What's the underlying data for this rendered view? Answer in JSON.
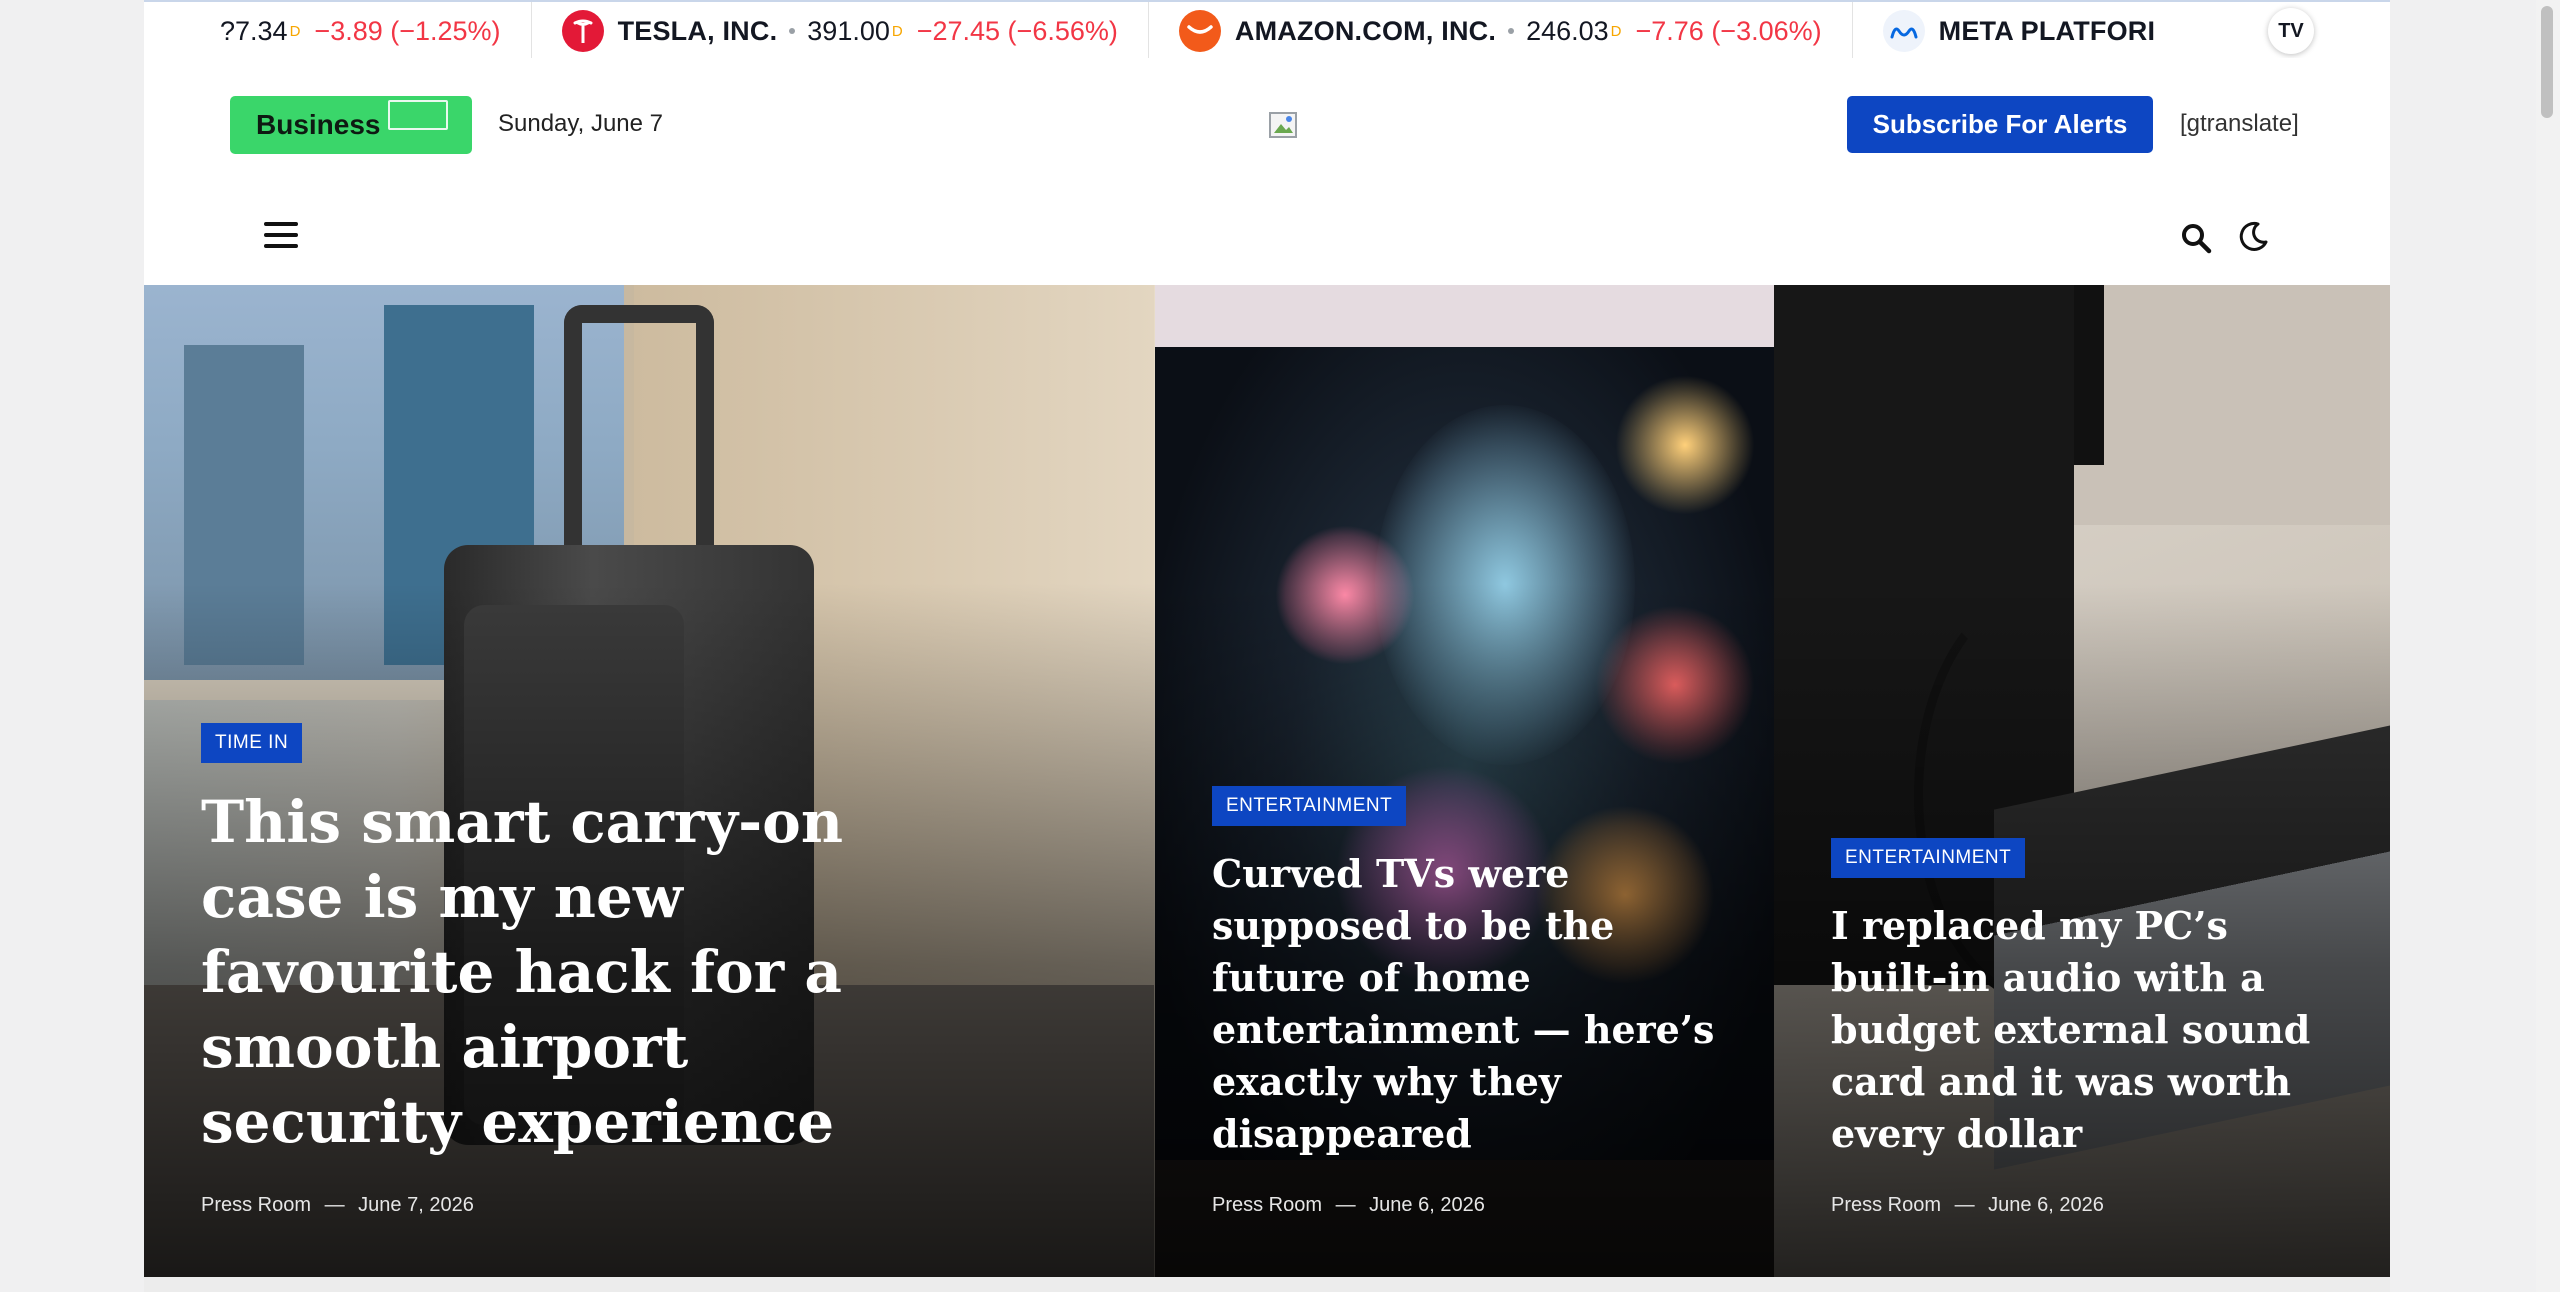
{
  "ticker": {
    "items": [
      {
        "partial_price": "?7.34",
        "sup": "D",
        "change": "−3.89 (−1.25%)"
      },
      {
        "logo": "tesla-logo",
        "logo_color": "#e31937",
        "name": "TESLA, INC.",
        "price": "391.00",
        "sup": "D",
        "change": "−27.45 (−6.56%)"
      },
      {
        "logo": "amazon-logo",
        "logo_color": "#f25a1a",
        "name": "AMAZON.COM, INC.",
        "price": "246.03",
        "sup": "D",
        "change": "−7.76 (−3.06%)"
      },
      {
        "logo": "meta-logo",
        "logo_color": "#0668e1",
        "name": "META PLATFORI"
      }
    ],
    "badge_text": "TV"
  },
  "header": {
    "category_label": "Business",
    "date": "Sunday, June 7",
    "subscribe_label": "Subscribe For Alerts",
    "gtranslate": "[gtranslate]"
  },
  "colors": {
    "accent_blue": "#0d46c2",
    "category_green": "#3ad66a",
    "ticker_negative": "#f23645"
  },
  "hero": {
    "cards": [
      {
        "category": "TIME IN",
        "title": "This smart carry-on case is my new favourite hack for a smooth airport security experience",
        "author": "Press Room",
        "separator": "—",
        "date": "June 7, 2026"
      },
      {
        "category": "ENTERTAINMENT",
        "title": "Curved TVs were supposed to be the future of home entertainment — here’s exactly why they disappeared",
        "author": "Press Room",
        "separator": "—",
        "date": "June 6, 2026"
      },
      {
        "category": "ENTERTAINMENT",
        "title": "I replaced my PC’s built-in audio with a budget external sound card and it was worth every dollar",
        "author": "Press Room",
        "separator": "—",
        "date": "June 6, 2026"
      }
    ]
  }
}
